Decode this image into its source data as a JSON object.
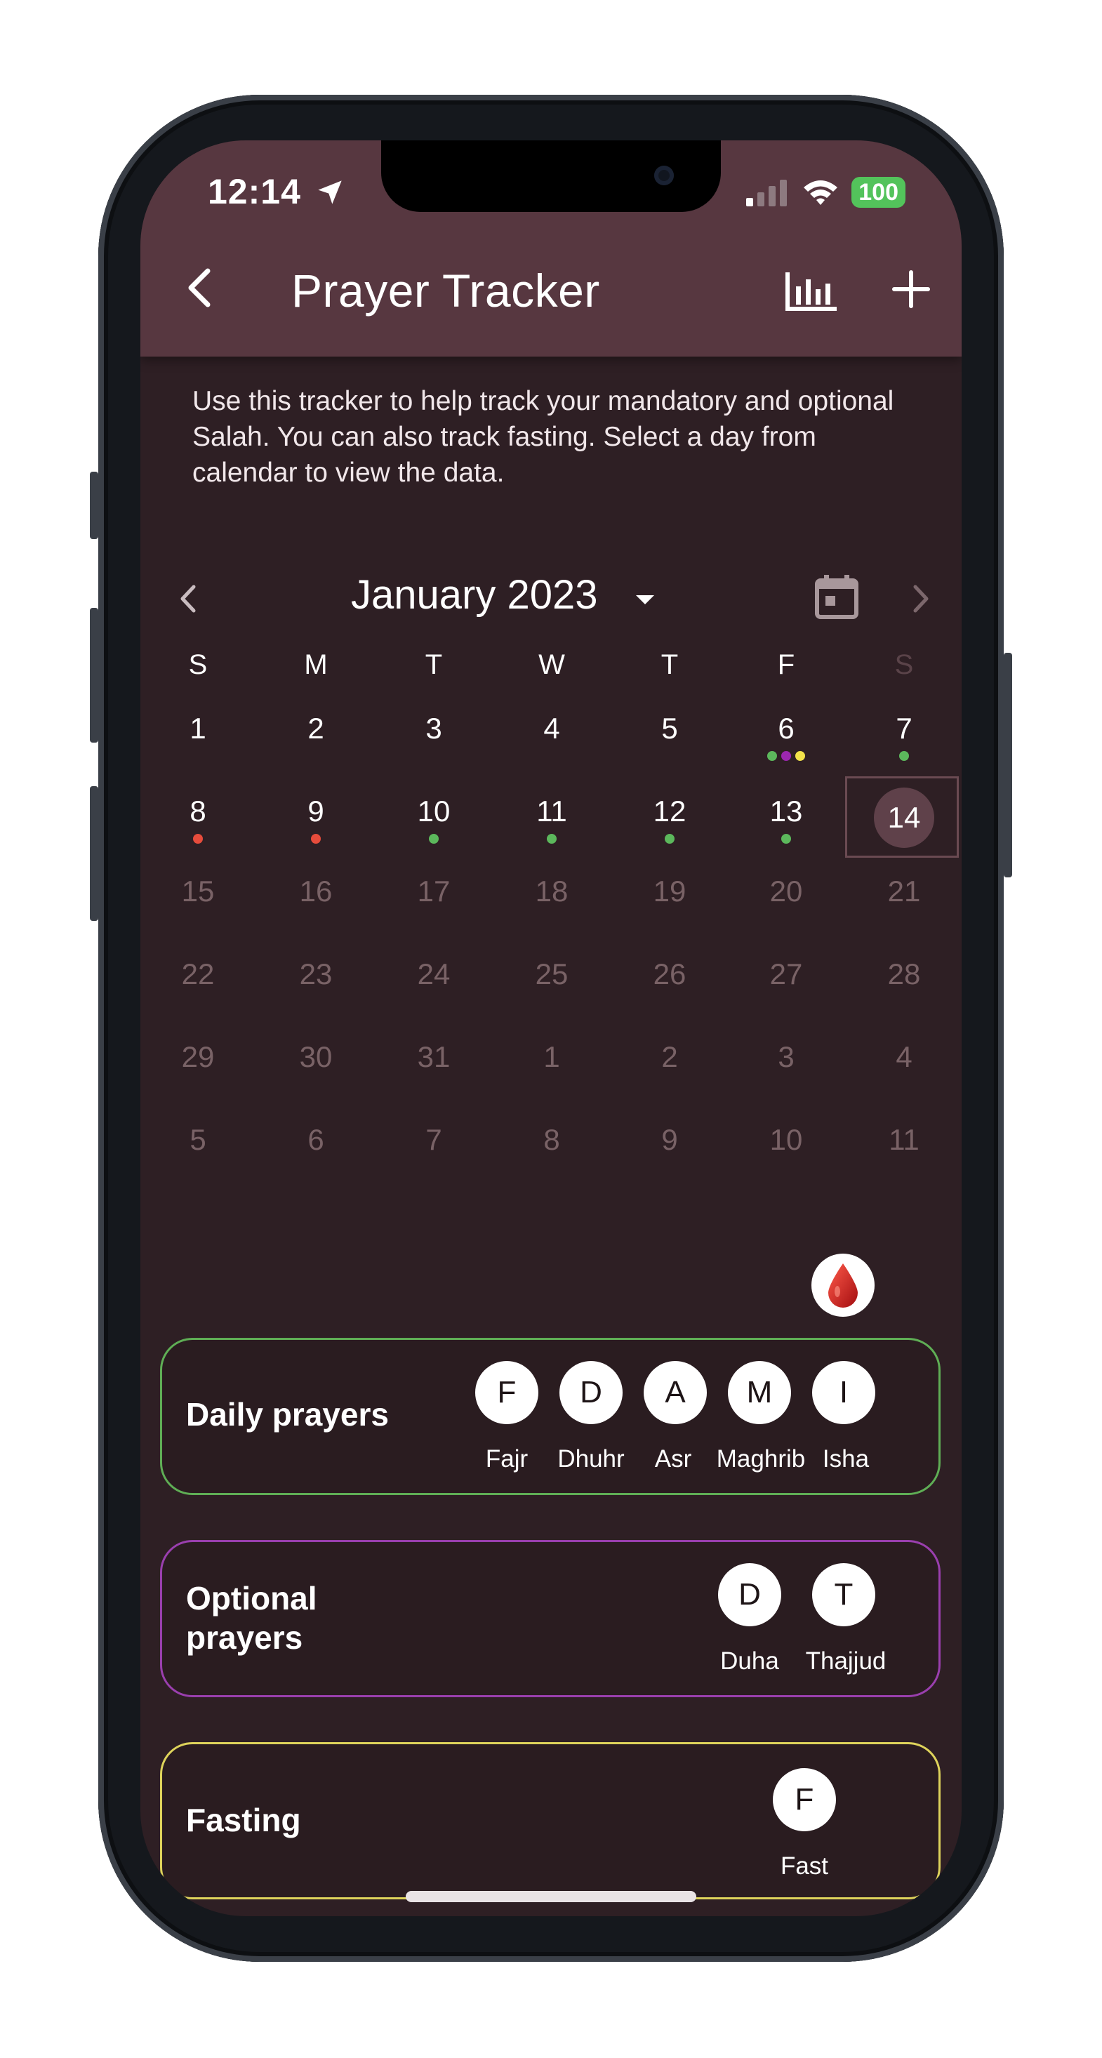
{
  "status_bar": {
    "time": "12:14",
    "battery": "100"
  },
  "header": {
    "title": "Prayer Tracker"
  },
  "intro_text": "Use this tracker to help track your mandatory and optional Salah. You can also track fasting. Select a day from calendar to view the data.",
  "calendar": {
    "month_label": "January 2023",
    "weekdays": [
      "S",
      "M",
      "T",
      "W",
      "T",
      "F",
      "S"
    ],
    "weeks": [
      [
        "1",
        "2",
        "3",
        "4",
        "5",
        "6",
        "7"
      ],
      [
        "8",
        "9",
        "10",
        "11",
        "12",
        "13",
        "14"
      ],
      [
        "15",
        "16",
        "17",
        "18",
        "19",
        "20",
        "21"
      ],
      [
        "22",
        "23",
        "24",
        "25",
        "26",
        "27",
        "28"
      ],
      [
        "29",
        "30",
        "31",
        "1",
        "2",
        "3",
        "4"
      ],
      [
        "5",
        "6",
        "7",
        "8",
        "9",
        "10",
        "11"
      ]
    ],
    "selected_day": "14"
  },
  "colors": {
    "dot_green": "#5cb85c",
    "dot_purple": "#9c27b0",
    "dot_yellow": "#f2e24a",
    "dot_red": "#e74c3c",
    "daily_border": "#5fae55",
    "optional_border": "#9a3fae",
    "fasting_border": "#ded35b"
  },
  "cards": {
    "daily": {
      "label": "Daily prayers",
      "items": [
        {
          "letter": "F",
          "name": "Fajr"
        },
        {
          "letter": "D",
          "name": "Dhuhr"
        },
        {
          "letter": "A",
          "name": "Asr"
        },
        {
          "letter": "M",
          "name": "Maghrib"
        },
        {
          "letter": "I",
          "name": "Isha"
        }
      ]
    },
    "optional": {
      "label_line1": "Optional",
      "label_line2": "prayers",
      "items": [
        {
          "letter": "D",
          "name": "Duha"
        },
        {
          "letter": "T",
          "name": "Thajjud"
        }
      ]
    },
    "fasting": {
      "label": "Fasting",
      "items": [
        {
          "letter": "F",
          "name": "Fast"
        }
      ]
    }
  }
}
